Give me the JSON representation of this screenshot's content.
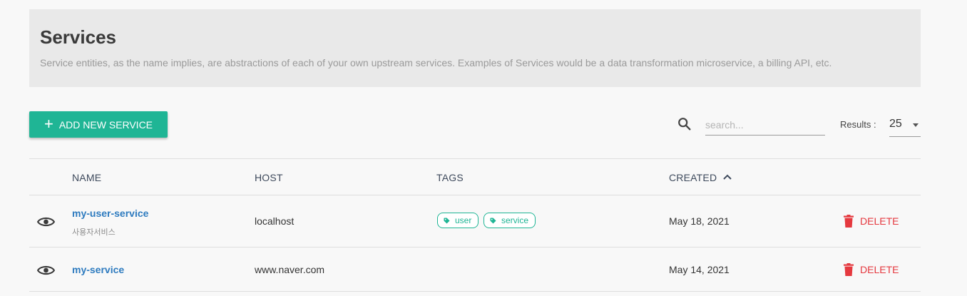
{
  "header": {
    "title": "Services",
    "description": "Service entities, as the name implies, are abstractions of each of your own upstream services. Examples of Services would be a data transformation microservice, a billing API, etc."
  },
  "toolbar": {
    "add_label": "ADD NEW SERVICE",
    "search_placeholder": "search...",
    "results_label": "Results :",
    "results_value": "25"
  },
  "table": {
    "columns": [
      "NAME",
      "HOST",
      "TAGS",
      "CREATED"
    ],
    "rows": [
      {
        "name": "my-user-service",
        "subname": "사용자서비스",
        "host": "localhost",
        "tags": [
          "user",
          "service"
        ],
        "created": "May 18, 2021",
        "delete_label": "DELETE"
      },
      {
        "name": "my-service",
        "host": "www.naver.com",
        "created": "May 14, 2021",
        "delete_label": "DELETE"
      }
    ]
  },
  "colors": {
    "accent": "#1fb595",
    "link": "#2e7bbf",
    "danger": "#e5393f"
  }
}
